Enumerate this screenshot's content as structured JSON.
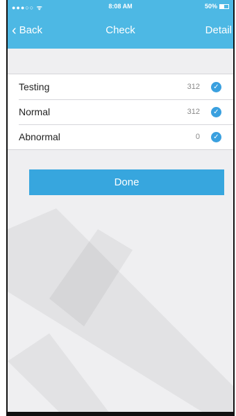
{
  "status_bar": {
    "carrier": "●●●○○ ᯤ",
    "time": "8:08 AM",
    "battery": "50%",
    "battery_level": 0.5
  },
  "nav": {
    "back_label": "Back",
    "title": "Check",
    "detail_label": "Detail"
  },
  "check_list": [
    {
      "label": "Testing",
      "count": "312",
      "checked": true
    },
    {
      "label": "Normal",
      "count": "312",
      "checked": true
    },
    {
      "label": "Abnormal",
      "count": "0",
      "checked": true
    }
  ],
  "done_label": "Done",
  "colors": {
    "accent": "#4db8e4",
    "button": "#37a6de",
    "check": "#3aa0df",
    "background": "#efeff1"
  },
  "icons": {
    "back": "chevron-left-icon",
    "check": "checkmark-circle-icon"
  }
}
